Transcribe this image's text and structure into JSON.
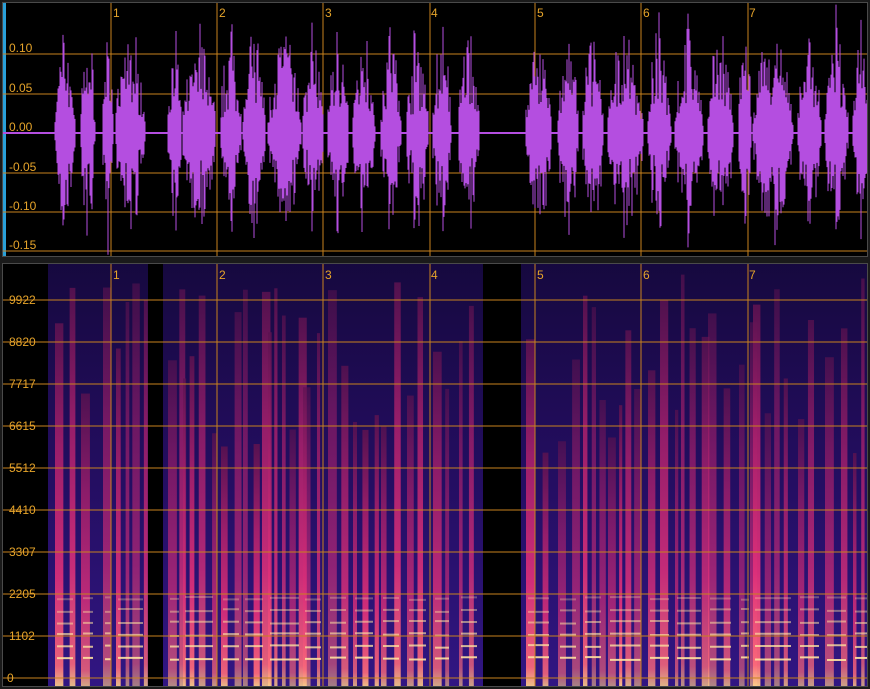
{
  "waveform": {
    "y_labels": [
      "0.10",
      "0.05",
      "0.00",
      "-0.05",
      "-0.10",
      "-0.15"
    ],
    "markers": [
      "1",
      "2",
      "3",
      "4",
      "5",
      "6",
      "7"
    ]
  },
  "spectrogram": {
    "y_labels": [
      "9922",
      "8820",
      "7717",
      "6615",
      "5512",
      "4410",
      "3307",
      "2205",
      "1102",
      "0"
    ],
    "markers": [
      "1",
      "2",
      "3",
      "4",
      "5",
      "6",
      "7"
    ]
  },
  "colors": {
    "gridline": "#c8821e",
    "label": "#e6a42a",
    "waveform": "#b44ee0",
    "accent": "#2aa0d8"
  }
}
